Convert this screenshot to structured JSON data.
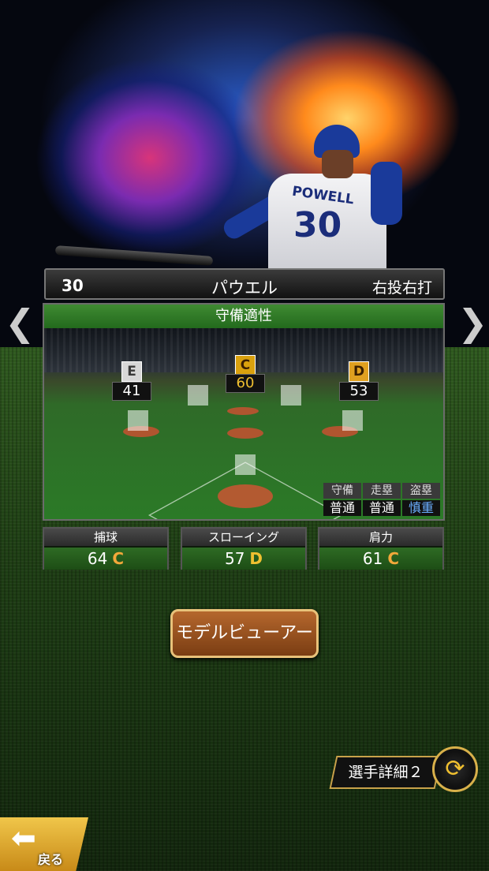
{
  "player": {
    "number": "30",
    "name": "パウエル",
    "hand": "右投右打",
    "jersey_name": "POWELL",
    "jersey_number": "30"
  },
  "defense": {
    "title": "守備適性",
    "positions": {
      "left": {
        "grade": "E",
        "value": "41"
      },
      "center": {
        "grade": "C",
        "value": "60"
      },
      "right": {
        "grade": "D",
        "value": "53"
      }
    },
    "mini": {
      "headers": [
        "守備",
        "走塁",
        "盗塁"
      ],
      "values": [
        "普通",
        "普通",
        "慎重"
      ]
    }
  },
  "stats": [
    {
      "label": "捕球",
      "value": "64",
      "grade": "C"
    },
    {
      "label": "スローイング",
      "value": "57",
      "grade": "D"
    },
    {
      "label": "肩力",
      "value": "61",
      "grade": "C"
    }
  ],
  "buttons": {
    "model_viewer": "モデルビューアー",
    "detail": "選手詳細２",
    "back": "戻る"
  },
  "nav": {
    "prev": "❮",
    "next": "❯"
  },
  "colors": {
    "grade_c": "#d9a10e",
    "grade_d": "#e0a020",
    "grade_e": "#d7d7d7",
    "field_green": "#2b7a27",
    "accent_gold": "#d8b04a"
  }
}
